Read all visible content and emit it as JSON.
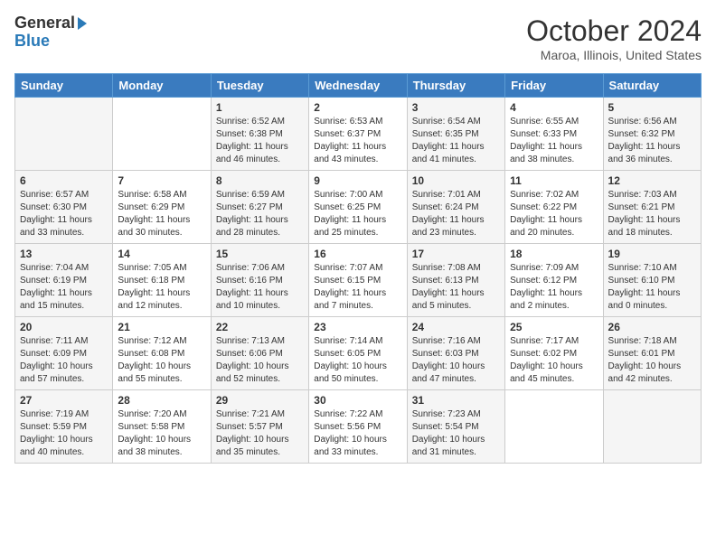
{
  "logo": {
    "general": "General",
    "blue": "Blue"
  },
  "title": "October 2024",
  "location": "Maroa, Illinois, United States",
  "days_of_week": [
    "Sunday",
    "Monday",
    "Tuesday",
    "Wednesday",
    "Thursday",
    "Friday",
    "Saturday"
  ],
  "weeks": [
    [
      {
        "num": "",
        "info": ""
      },
      {
        "num": "",
        "info": ""
      },
      {
        "num": "1",
        "info": "Sunrise: 6:52 AM\nSunset: 6:38 PM\nDaylight: 11 hours and 46 minutes."
      },
      {
        "num": "2",
        "info": "Sunrise: 6:53 AM\nSunset: 6:37 PM\nDaylight: 11 hours and 43 minutes."
      },
      {
        "num": "3",
        "info": "Sunrise: 6:54 AM\nSunset: 6:35 PM\nDaylight: 11 hours and 41 minutes."
      },
      {
        "num": "4",
        "info": "Sunrise: 6:55 AM\nSunset: 6:33 PM\nDaylight: 11 hours and 38 minutes."
      },
      {
        "num": "5",
        "info": "Sunrise: 6:56 AM\nSunset: 6:32 PM\nDaylight: 11 hours and 36 minutes."
      }
    ],
    [
      {
        "num": "6",
        "info": "Sunrise: 6:57 AM\nSunset: 6:30 PM\nDaylight: 11 hours and 33 minutes."
      },
      {
        "num": "7",
        "info": "Sunrise: 6:58 AM\nSunset: 6:29 PM\nDaylight: 11 hours and 30 minutes."
      },
      {
        "num": "8",
        "info": "Sunrise: 6:59 AM\nSunset: 6:27 PM\nDaylight: 11 hours and 28 minutes."
      },
      {
        "num": "9",
        "info": "Sunrise: 7:00 AM\nSunset: 6:25 PM\nDaylight: 11 hours and 25 minutes."
      },
      {
        "num": "10",
        "info": "Sunrise: 7:01 AM\nSunset: 6:24 PM\nDaylight: 11 hours and 23 minutes."
      },
      {
        "num": "11",
        "info": "Sunrise: 7:02 AM\nSunset: 6:22 PM\nDaylight: 11 hours and 20 minutes."
      },
      {
        "num": "12",
        "info": "Sunrise: 7:03 AM\nSunset: 6:21 PM\nDaylight: 11 hours and 18 minutes."
      }
    ],
    [
      {
        "num": "13",
        "info": "Sunrise: 7:04 AM\nSunset: 6:19 PM\nDaylight: 11 hours and 15 minutes."
      },
      {
        "num": "14",
        "info": "Sunrise: 7:05 AM\nSunset: 6:18 PM\nDaylight: 11 hours and 12 minutes."
      },
      {
        "num": "15",
        "info": "Sunrise: 7:06 AM\nSunset: 6:16 PM\nDaylight: 11 hours and 10 minutes."
      },
      {
        "num": "16",
        "info": "Sunrise: 7:07 AM\nSunset: 6:15 PM\nDaylight: 11 hours and 7 minutes."
      },
      {
        "num": "17",
        "info": "Sunrise: 7:08 AM\nSunset: 6:13 PM\nDaylight: 11 hours and 5 minutes."
      },
      {
        "num": "18",
        "info": "Sunrise: 7:09 AM\nSunset: 6:12 PM\nDaylight: 11 hours and 2 minutes."
      },
      {
        "num": "19",
        "info": "Sunrise: 7:10 AM\nSunset: 6:10 PM\nDaylight: 11 hours and 0 minutes."
      }
    ],
    [
      {
        "num": "20",
        "info": "Sunrise: 7:11 AM\nSunset: 6:09 PM\nDaylight: 10 hours and 57 minutes."
      },
      {
        "num": "21",
        "info": "Sunrise: 7:12 AM\nSunset: 6:08 PM\nDaylight: 10 hours and 55 minutes."
      },
      {
        "num": "22",
        "info": "Sunrise: 7:13 AM\nSunset: 6:06 PM\nDaylight: 10 hours and 52 minutes."
      },
      {
        "num": "23",
        "info": "Sunrise: 7:14 AM\nSunset: 6:05 PM\nDaylight: 10 hours and 50 minutes."
      },
      {
        "num": "24",
        "info": "Sunrise: 7:16 AM\nSunset: 6:03 PM\nDaylight: 10 hours and 47 minutes."
      },
      {
        "num": "25",
        "info": "Sunrise: 7:17 AM\nSunset: 6:02 PM\nDaylight: 10 hours and 45 minutes."
      },
      {
        "num": "26",
        "info": "Sunrise: 7:18 AM\nSunset: 6:01 PM\nDaylight: 10 hours and 42 minutes."
      }
    ],
    [
      {
        "num": "27",
        "info": "Sunrise: 7:19 AM\nSunset: 5:59 PM\nDaylight: 10 hours and 40 minutes."
      },
      {
        "num": "28",
        "info": "Sunrise: 7:20 AM\nSunset: 5:58 PM\nDaylight: 10 hours and 38 minutes."
      },
      {
        "num": "29",
        "info": "Sunrise: 7:21 AM\nSunset: 5:57 PM\nDaylight: 10 hours and 35 minutes."
      },
      {
        "num": "30",
        "info": "Sunrise: 7:22 AM\nSunset: 5:56 PM\nDaylight: 10 hours and 33 minutes."
      },
      {
        "num": "31",
        "info": "Sunrise: 7:23 AM\nSunset: 5:54 PM\nDaylight: 10 hours and 31 minutes."
      },
      {
        "num": "",
        "info": ""
      },
      {
        "num": "",
        "info": ""
      }
    ]
  ]
}
